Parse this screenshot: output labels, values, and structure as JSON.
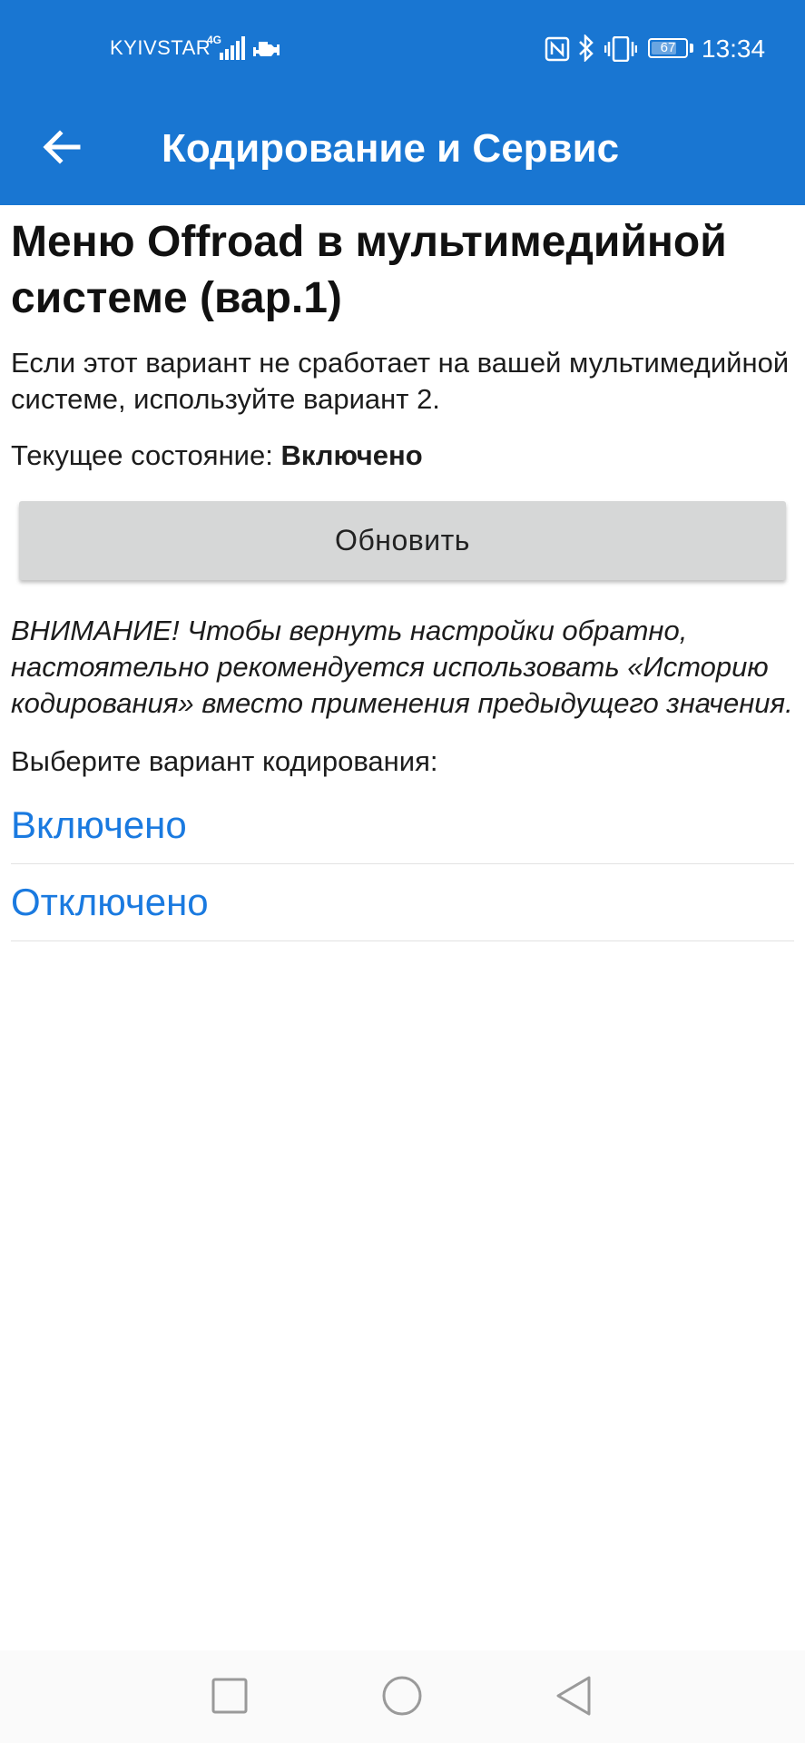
{
  "status_bar": {
    "carrier": "KYIVSTAR",
    "network_type": "4G",
    "time": "13:34",
    "battery_level": "67",
    "icons": [
      "signal-icon",
      "engine-icon",
      "nfc-icon",
      "bluetooth-icon",
      "vibrate-icon",
      "battery-icon"
    ]
  },
  "app_bar": {
    "title": "Кодирование и Сервис",
    "back_icon": "arrow-left-icon",
    "background_color": "#1976d2"
  },
  "main": {
    "title": "Меню Offroad в мультимедийной системе (вар.1)",
    "description": "Если этот вариант не сработает на вашей мультимедийной системе, используйте вариант 2.",
    "state_label": "Текущее состояние:",
    "state_value": "Включено",
    "refresh_label": "Обновить",
    "warning": "ВНИМАНИЕ! Чтобы вернуть настройки обратно, настоятельно рекомендуется использовать «Историю кодирования» вместо применения предыдущего значения.",
    "choose_label": "Выберите вариант кодирования:",
    "options": [
      {
        "label": "Включено"
      },
      {
        "label": "Отключено"
      }
    ],
    "link_color": "#1a7ae0"
  },
  "nav_bar": {
    "icons": [
      "recents-square-icon",
      "home-circle-icon",
      "back-triangle-icon"
    ]
  }
}
